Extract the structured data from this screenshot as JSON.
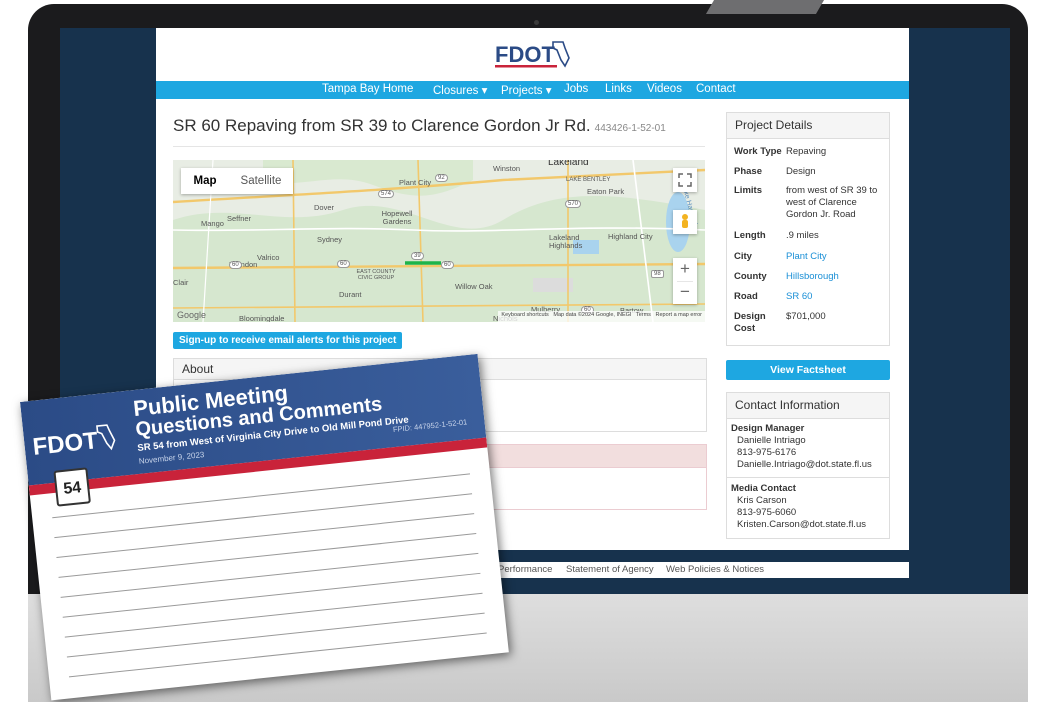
{
  "site": {
    "logo_text": "FDOT",
    "nav": [
      "Tampa Bay Home",
      "Closures ▾",
      "Projects ▾",
      "Jobs",
      "Links",
      "Videos",
      "Contact"
    ]
  },
  "project": {
    "title": "SR 60 Repaving from SR 39 to Clarence Gordon Jr Rd.",
    "fpid": "443426-1-52-01",
    "signup_label": "Sign-up to receive email alerts for this project",
    "about_heading": "About"
  },
  "map": {
    "toggle_map": "Map",
    "toggle_satellite": "Satellite",
    "labels": [
      "Winston",
      "Lakeland",
      "Plant City",
      "LAKE BENTLEY",
      "Eaton Park",
      "Dover",
      "Hopewell Gardens",
      "Mango",
      "Seffner",
      "Sydney",
      "Lakeland Highlands",
      "Highland City",
      "Lake Hancock",
      "Valrico",
      "Brandon",
      "EAST COUNTY CIVIC GROUP",
      "Durant",
      "Willow Oak",
      "Mulberry",
      "Bartow",
      "Nichols",
      "Bloomingdale",
      "Clair",
      "Google"
    ],
    "roads": [
      "574",
      "92",
      "570",
      "39",
      "60",
      "60",
      "60",
      "98",
      "60"
    ],
    "footer": [
      "Keyboard shortcuts",
      "Map data ©2024 Google, INEGI",
      "Terms",
      "Report a map error"
    ],
    "zoom_in": "+",
    "zoom_out": "−"
  },
  "details": {
    "heading": "Project Details",
    "rows": [
      {
        "label": "Work Type",
        "value": "Repaving",
        "link": false
      },
      {
        "label": "Phase",
        "value": "Design",
        "link": false
      },
      {
        "label": "Limits",
        "value": "from west of SR 39 to west of Clarence Gordon Jr. Road",
        "link": false
      },
      {
        "label": "Length",
        "value": ".9 miles",
        "link": false
      },
      {
        "label": "City",
        "value": "Plant City",
        "link": true
      },
      {
        "label": "County",
        "value": "Hillsborough",
        "link": true
      },
      {
        "label": "Road",
        "value": "SR 60",
        "link": true
      },
      {
        "label": "Design Cost",
        "value": "$701,000",
        "link": false
      }
    ],
    "factsheet_label": "View Factsheet"
  },
  "contact": {
    "heading": "Contact Information",
    "design_manager": {
      "role": "Design Manager",
      "name": "Danielle Intriago",
      "phone": "813-975-6176",
      "email": "Danielle.Intriago@dot.state.fl.us"
    },
    "media_contact": {
      "role": "Media Contact",
      "name": "Kris Carson",
      "phone": "813-975-6060",
      "email": "Kristen.Carson@dot.state.fl.us"
    }
  },
  "footer": {
    "links": [
      "Performance",
      "Statement of Agency",
      "Web Policies & Notices"
    ]
  },
  "flyer": {
    "logo_text": "FDOT",
    "heading_line1": "Public Meeting",
    "heading_line2": "Questions and Comments",
    "subtitle": "SR 54 from West of Virginia City Drive to Old Mill Pond Drive",
    "date": "November 9, 2023",
    "fpid": "FPID: 447952-1-52-01",
    "shield_number": "54"
  },
  "colors": {
    "nav_blue": "#1ea7e1",
    "link_blue": "#1a8fd6",
    "footer_navy": "#17324d",
    "flyer_blue": "#2b4b86",
    "flyer_red": "#c9233a"
  }
}
